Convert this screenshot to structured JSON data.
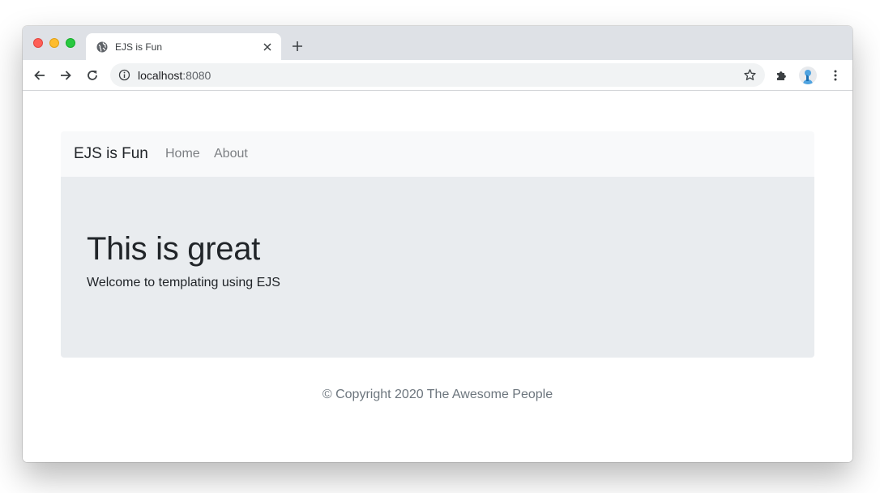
{
  "browser": {
    "tab_title": "EJS is Fun",
    "url_host": "localhost",
    "url_port": ":8080",
    "icons": [
      "globe-icon",
      "close-icon",
      "plus-icon",
      "back-arrow-icon",
      "forward-arrow-icon",
      "reload-icon",
      "info-icon",
      "star-icon",
      "extensions-icon",
      "profile-avatar",
      "more-icon"
    ]
  },
  "navbar": {
    "brand": "EJS is Fun",
    "links": [
      {
        "label": "Home"
      },
      {
        "label": "About"
      }
    ]
  },
  "jumbotron": {
    "title": "This is great",
    "lead": "Welcome to templating using EJS"
  },
  "footer": {
    "text": "© Copyright 2020 The Awesome People"
  },
  "colors": {
    "navbar_bg": "#f8f9fa",
    "jumbotron_bg": "#e9ecef",
    "text": "#212529",
    "muted": "#6c757d"
  }
}
